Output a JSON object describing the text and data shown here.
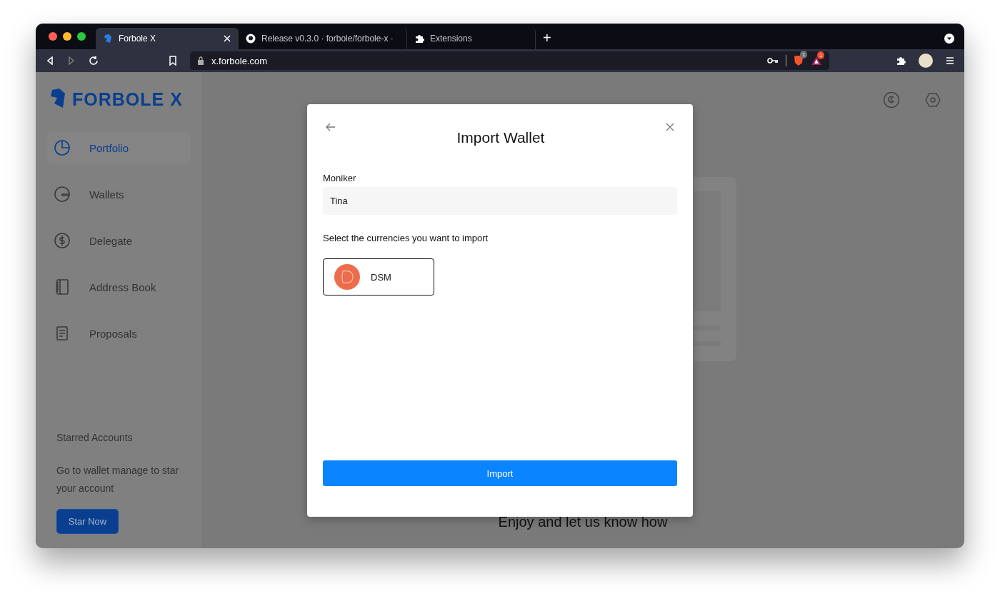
{
  "browser": {
    "tabs": [
      {
        "title": "Forbole X",
        "selected": true
      },
      {
        "title": "Release v0.3.0 · forbole/forbole-x ·",
        "selected": false
      },
      {
        "title": "Extensions",
        "selected": false
      }
    ],
    "new_tab": "+",
    "address": "x.forbole.com",
    "shields_count": "1",
    "rewards_count": "1"
  },
  "sidebar": {
    "logo": "FORBOLE X",
    "items": [
      {
        "label": "Portfolio",
        "selected": true
      },
      {
        "label": "Wallets",
        "selected": false
      },
      {
        "label": "Delegate",
        "selected": false
      },
      {
        "label": "Address Book",
        "selected": false
      },
      {
        "label": "Proposals",
        "selected": false
      }
    ],
    "starred_title": "Starred Accounts",
    "starred_text": "Go to wallet manage to star your account",
    "star_button": "Star Now"
  },
  "main": {
    "caption": "Enjoy and let us know how"
  },
  "modal": {
    "title": "Import Wallet",
    "moniker_label": "Moniker",
    "moniker_value": "Tina",
    "currencies_label": "Select the currencies you want to import",
    "currencies": [
      {
        "name": "DSM",
        "selected": true
      }
    ],
    "import_button": "Import"
  }
}
